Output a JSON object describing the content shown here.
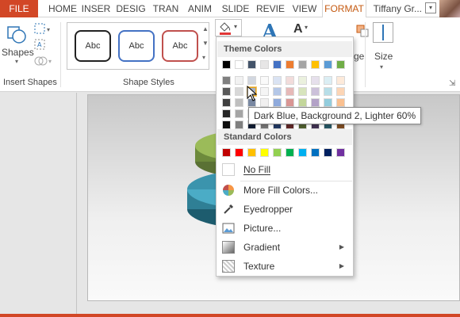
{
  "tabs": [
    "FILE",
    "HOME",
    "INSER",
    "DESIG",
    "TRAN",
    "ANIM",
    "SLIDE",
    "REVIE",
    "VIEW",
    "FORMAT"
  ],
  "user": "Tiffany Gr...",
  "ribbon": {
    "shapes_label": "Shapes",
    "insert_shapes_label": "Insert Shapes",
    "shape_styles_label": "Shape Styles",
    "style_sample": "Abc",
    "size_label": "Size",
    "arrange_partial": "ge"
  },
  "colors": {
    "theme_row0": [
      "#000000",
      "#ffffff",
      "#44546a",
      "#e7e6e6",
      "#4472c4",
      "#ed7d31",
      "#a5a5a5",
      "#ffc000",
      "#5b9bd5",
      "#70ad47"
    ],
    "theme_col_top": [
      "#000000",
      "#ffffff",
      "#1f3864",
      "#e7e6e6",
      "#4472c4",
      "#c0504d",
      "#9bbb59",
      "#8064a2",
      "#4bacc6",
      "#f79646"
    ],
    "standard": [
      "#c00000",
      "#ff0000",
      "#ffc000",
      "#ffff00",
      "#92d050",
      "#00b050",
      "#00b0f0",
      "#0070c0",
      "#002060",
      "#7030a0"
    ]
  },
  "menu": {
    "theme_header": "Theme Colors",
    "standard_header": "Standard Colors",
    "no_fill": "No Fill",
    "more_colors": "More Fill Colors...",
    "eyedropper": "Eyedropper",
    "picture": "Picture...",
    "gradient": "Gradient",
    "texture": "Texture"
  },
  "tooltip": "Dark Blue, Background 2, Lighter 60%"
}
